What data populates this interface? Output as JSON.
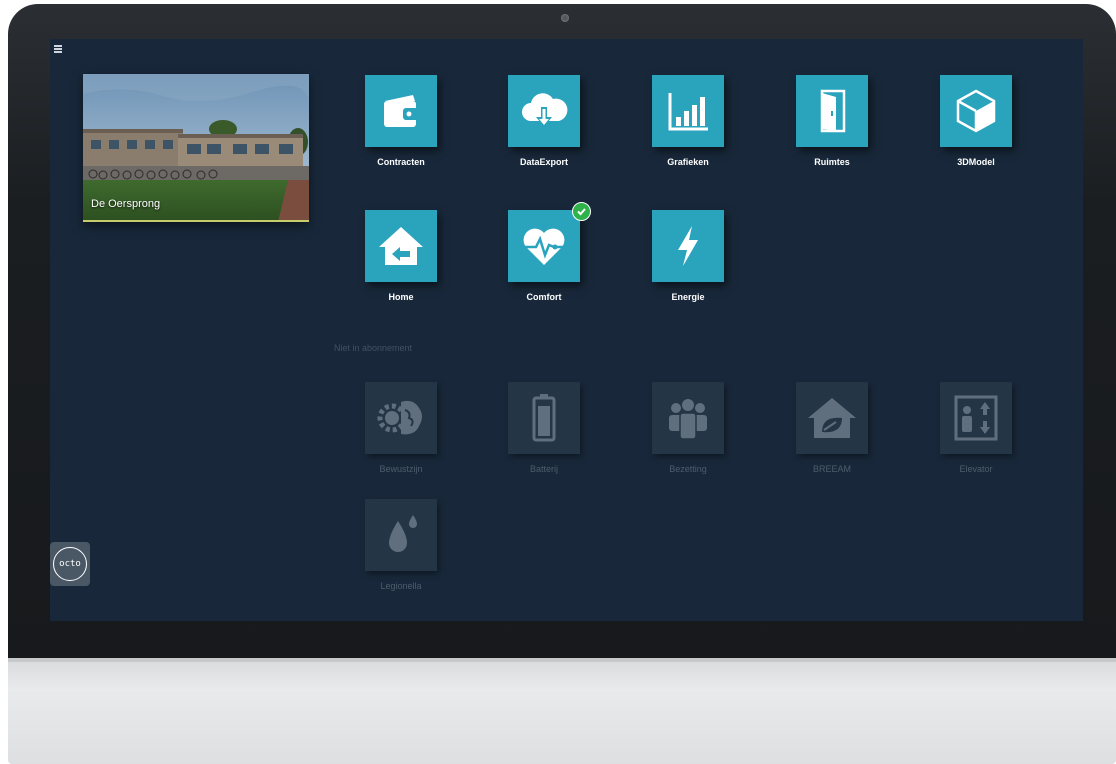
{
  "site": {
    "title": "De Oersprong"
  },
  "apps": [
    {
      "label": "Contracten",
      "icon": "wallet-icon"
    },
    {
      "label": "DataExport",
      "icon": "cloud-download-icon"
    },
    {
      "label": "Grafieken",
      "icon": "bar-chart-icon"
    },
    {
      "label": "Ruimtes",
      "icon": "door-icon"
    },
    {
      "label": "3DModel",
      "icon": "cube-icon"
    },
    {
      "label": "Home",
      "icon": "home-icon"
    },
    {
      "label": "Comfort",
      "icon": "heart-pulse-icon",
      "badge": "check-icon"
    },
    {
      "label": "Energie",
      "icon": "lightning-icon"
    }
  ],
  "unsubscribed": {
    "label": "Niet in abonnement",
    "apps": [
      {
        "label": "Bewustzijn",
        "icon": "brain-gear-icon"
      },
      {
        "label": "Batterij",
        "icon": "battery-icon"
      },
      {
        "label": "Bezetting",
        "icon": "people-icon"
      },
      {
        "label": "BREEAM",
        "icon": "eco-house-icon"
      },
      {
        "label": "Elevator",
        "icon": "elevator-icon"
      },
      {
        "label": "Legionella",
        "icon": "water-drop-icon"
      }
    ]
  },
  "logo": {
    "text": "octo"
  },
  "colors": {
    "accent": "#2aa3bd",
    "screen": "#18283a",
    "badge": "#2eb34a"
  }
}
